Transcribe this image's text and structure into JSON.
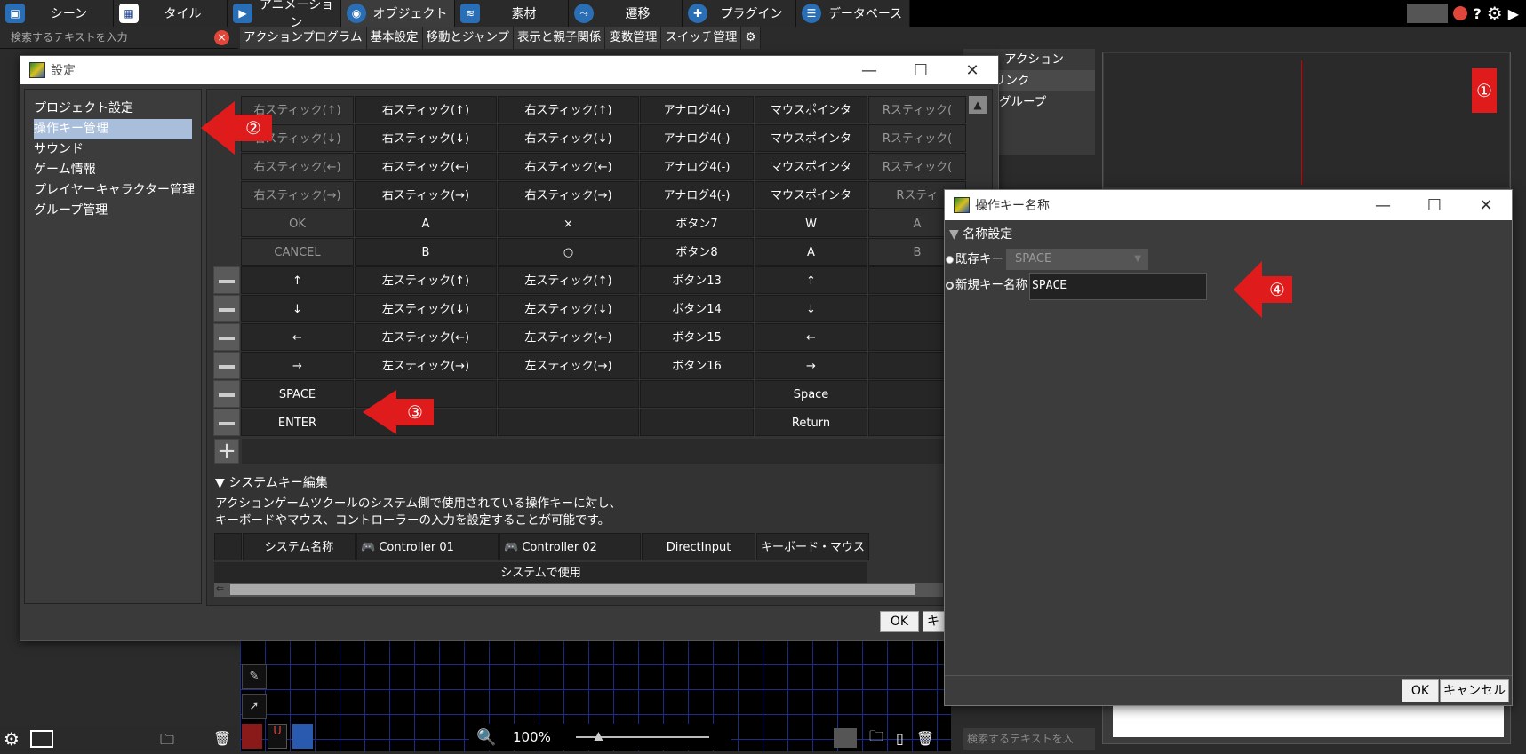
{
  "menubar": {
    "tabs": [
      {
        "label": "シーン",
        "icon": "scene-icon"
      },
      {
        "label": "タイル",
        "icon": "tile-icon"
      },
      {
        "label": "アニメーション",
        "icon": "animation-icon"
      },
      {
        "label": "オブジェクト",
        "icon": "object-icon"
      },
      {
        "label": "素材",
        "icon": "material-icon"
      },
      {
        "label": "遷移",
        "icon": "transition-icon"
      },
      {
        "label": "プラグイン",
        "icon": "plugin-icon"
      },
      {
        "label": "データベース",
        "icon": "database-icon"
      }
    ],
    "right_help": "?"
  },
  "search_top": {
    "placeholder": "検索するテキストを入力"
  },
  "subtabs": [
    "アクションプログラム",
    "基本設定",
    "移動とジャンプ",
    "表示と親子関係",
    "変数管理",
    "スイッチ管理"
  ],
  "bg_list": [
    "アクション",
    "リンク",
    "グループ"
  ],
  "settings": {
    "title": "設定",
    "categories": [
      "プロジェクト設定",
      "操作キー管理",
      "サウンド",
      "ゲーム情報",
      "プレイヤーキャラクター管理",
      "グループ管理"
    ],
    "selected_category": 1,
    "key_rows": [
      {
        "name": "右スティック(↑)",
        "c1": "右スティック(↑)",
        "c2": "右スティック(↑)",
        "c3": "アナログ4(-)",
        "c4": "マウスポインタ",
        "c5": "Rスティック(",
        "dim": true
      },
      {
        "name": "右スティック(↓)",
        "c1": "右スティック(↓)",
        "c2": "右スティック(↓)",
        "c3": "アナログ4(-)",
        "c4": "マウスポインタ",
        "c5": "Rスティック(",
        "dim": true
      },
      {
        "name": "右スティック(←)",
        "c1": "右スティック(←)",
        "c2": "右スティック(←)",
        "c3": "アナログ4(-)",
        "c4": "マウスポインタ",
        "c5": "Rスティック(",
        "dim": true
      },
      {
        "name": "右スティック(→)",
        "c1": "右スティック(→)",
        "c2": "右スティック(→)",
        "c3": "アナログ4(-)",
        "c4": "マウスポインタ",
        "c5": "Rスティ",
        "dim": true
      },
      {
        "name": "OK",
        "c1": "A",
        "c2": "×",
        "c3": "ボタン7",
        "c4": "W",
        "c5": "A",
        "dim": true
      },
      {
        "name": "CANCEL",
        "c1": "B",
        "c2": "○",
        "c3": "ボタン8",
        "c4": "A",
        "c5": "B",
        "dim": true
      },
      {
        "name": "↑",
        "c1": "左スティック(↑)",
        "c2": "左スティック(↑)",
        "c3": "ボタン13",
        "c4": "↑",
        "c5": "",
        "dim": false
      },
      {
        "name": "↓",
        "c1": "左スティック(↓)",
        "c2": "左スティック(↓)",
        "c3": "ボタン14",
        "c4": "↓",
        "c5": "",
        "dim": false
      },
      {
        "name": "←",
        "c1": "左スティック(←)",
        "c2": "左スティック(←)",
        "c3": "ボタン15",
        "c4": "←",
        "c5": "",
        "dim": false
      },
      {
        "name": "→",
        "c1": "左スティック(→)",
        "c2": "左スティック(→)",
        "c3": "ボタン16",
        "c4": "→",
        "c5": "",
        "dim": false
      },
      {
        "name": "SPACE",
        "c1": "",
        "c2": "",
        "c3": "",
        "c4": "Space",
        "c5": "",
        "dim": false
      },
      {
        "name": "ENTER",
        "c1": "",
        "c2": "",
        "c3": "",
        "c4": "Return",
        "c5": "",
        "dim": false
      }
    ],
    "sys_header": "システムキー編集",
    "sys_desc_1": "アクションゲームツクールのシステム側で使用されている操作キーに対し、",
    "sys_desc_2": "キーボードやマウス、コントローラーの入力を設定することが可能です。",
    "sys_columns": [
      "システム名称",
      "Controller 01",
      "Controller 02",
      "DirectInput",
      "キーボード・マウス"
    ],
    "sys_used": "システムで使用",
    "ok_label": "OK",
    "cancel_label": "キ"
  },
  "keyname_dialog": {
    "title": "操作キー名称",
    "section": "名称設定",
    "existing_label": "既存キー",
    "existing_value": "SPACE",
    "new_label": "新規キー名称",
    "new_value": "SPACE",
    "ok_label": "OK",
    "cancel_label": "キャンセル"
  },
  "annotations": [
    "①",
    "②",
    "③",
    "④"
  ],
  "zoom": {
    "value": "100%"
  },
  "bottom_search_placeholder": "検索するテキストを入",
  "colors": {
    "accent": "#2a6fb5",
    "arrow": "#e01b1b",
    "selected": "#a8bedb",
    "grid": "#1b2d8a"
  }
}
